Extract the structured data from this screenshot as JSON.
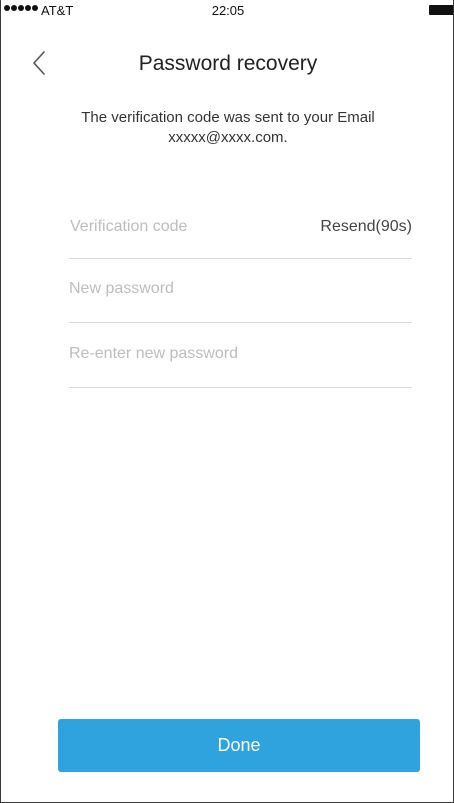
{
  "status_bar": {
    "carrier": "AT&T",
    "time": "22:05",
    "signal_bars": 5
  },
  "nav": {
    "back_icon": "chevron-left-icon",
    "title": "Password recovery"
  },
  "info": {
    "message": "The verification code was sent to your Email xxxxx@xxxx.com."
  },
  "form": {
    "verification_code": {
      "value": "",
      "placeholder": "Verification code"
    },
    "resend_label": "Resend(90s)",
    "new_password": {
      "value": "",
      "placeholder": "New password"
    },
    "confirm_password": {
      "value": "",
      "placeholder": "Re-enter new password"
    }
  },
  "done_label": "Done",
  "colors": {
    "accent": "#2fa3de",
    "divider": "#d9d9d9",
    "placeholder": "#bdbdbd"
  }
}
